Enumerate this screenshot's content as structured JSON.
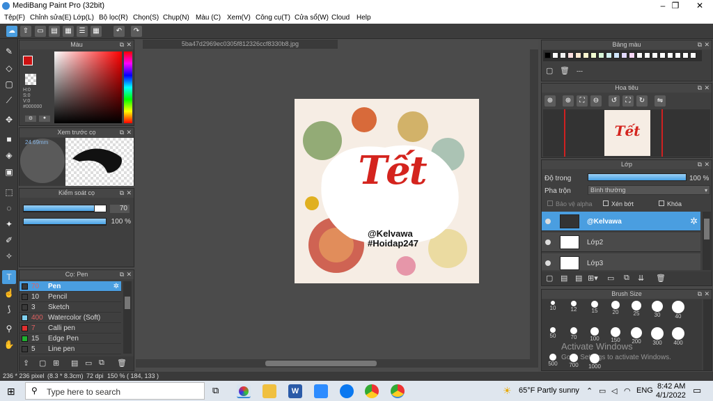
{
  "window": {
    "title": "MediBang Paint Pro (32bit)",
    "minimize": "–",
    "maximize": "❐",
    "close": "✕"
  },
  "menu": [
    "Tệp(F)",
    "Chỉnh sửa(E)",
    "Lớp(L)",
    "Bộ lọc(R)",
    "Chọn(S)",
    "Chụp(N)",
    "Màu (C)",
    "Xem(V)",
    "Công cụ(T)",
    "Cửa sổ(W)",
    "Cloud",
    "Help"
  ],
  "document_tab": "5ba47d2969ec0305f812326ccf8330b8.jpg",
  "color_panel": {
    "title": "Màu",
    "h": "H:0",
    "s": "S:0",
    "v": "V:0",
    "hex": "#000000"
  },
  "preview_panel": {
    "title": "Xem trước cọ",
    "size": "24.69mm"
  },
  "control_panel": {
    "title": "Kiểm soát cọ",
    "size_value": "70",
    "opacity_value": "100 %",
    "size_fraction": 0.86,
    "opacity_fraction": 1.0
  },
  "brush_panel": {
    "title": "Cọ: Pen",
    "brushes": [
      {
        "num": "70",
        "label": "Pen",
        "color": "#3a3a3a",
        "selected": true
      },
      {
        "num": "10",
        "label": "Pencil",
        "color": "#3a3a3a",
        "selected": false
      },
      {
        "num": "3",
        "label": "Sketch",
        "color": "#3a3a3a",
        "selected": false
      },
      {
        "num": "400",
        "label": "Watercolor (Soft)",
        "color": "#7fd0f0",
        "selected": false
      },
      {
        "num": "7",
        "label": "Calli pen",
        "color": "#e03030",
        "selected": false
      },
      {
        "num": "15",
        "label": "Edge Pen",
        "color": "#20b030",
        "selected": false
      },
      {
        "num": "5",
        "label": "Line pen",
        "color": "#3a3a3a",
        "selected": false
      }
    ]
  },
  "artwork": {
    "title": "Tết",
    "line1": "@Kelvawa",
    "line2": "#Hoidap247"
  },
  "palette_panel": {
    "title": "Bảng màu",
    "entry": "---"
  },
  "navigator_panel": {
    "title": "Hoa tiêu"
  },
  "layer_panel": {
    "title": "Lớp",
    "opacity_label": "Độ trong",
    "opacity_value": "100 %",
    "blend_label": "Pha trộn",
    "blend_value": "Bình thường",
    "protect_alpha": "Bảo vệ alpha",
    "clipping": "Xén bớt",
    "lock": "Khóa",
    "layers": [
      {
        "name": "@Kelvawa",
        "selected": true
      },
      {
        "name": "Lớp2",
        "selected": false
      },
      {
        "name": "Lớp3",
        "selected": false
      }
    ]
  },
  "brushsize_panel": {
    "title": "Brush Size",
    "sizes": [
      "10",
      "12",
      "15",
      "20",
      "25",
      "30",
      "40",
      "50",
      "70",
      "100",
      "150",
      "200",
      "300",
      "400",
      "500",
      "700",
      "1000"
    ]
  },
  "watermark": {
    "line1": "Activate Windows",
    "line2": "Go to Settings to activate Windows."
  },
  "status": {
    "size": "236 * 236 pixel",
    "dims": "(8.3 * 8.3cm)",
    "dpi": "72 dpi",
    "zoom": "150 %",
    "coords": "( 184, 133 )"
  },
  "taskbar": {
    "search_placeholder": "Type here to search",
    "weather": "65°F  Partly sunny",
    "lang": "ENG",
    "time": "8:42 AM",
    "date": "4/1/2022"
  },
  "colors": {
    "accent": "#4a9ee0",
    "fg_color": "#cc1111"
  }
}
